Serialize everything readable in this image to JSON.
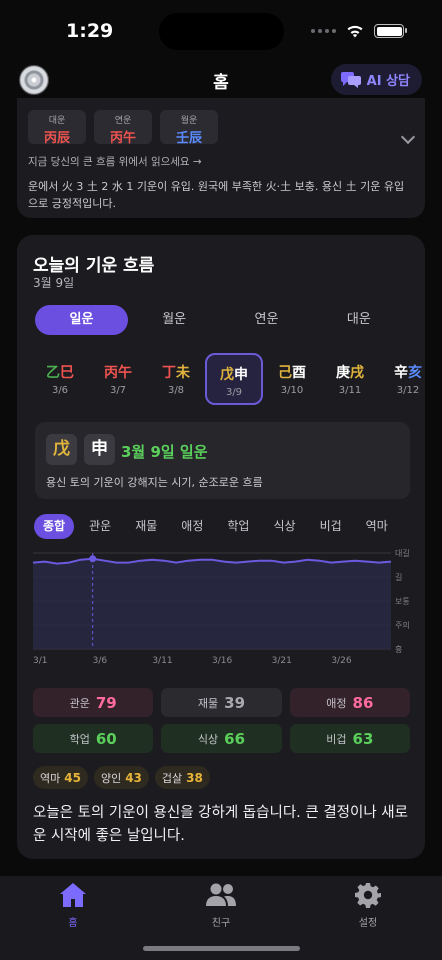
{
  "status": {
    "time": "1:29"
  },
  "nav": {
    "title": "홈",
    "ai_button": "AI 상담"
  },
  "fortune_card": {
    "pills": [
      {
        "label": "대운",
        "value": "丙辰",
        "color": "#ef5350"
      },
      {
        "label": "연운",
        "value": "丙午",
        "color": "#ef5350"
      },
      {
        "label": "월운",
        "value": "壬辰",
        "color": "#5b8cff"
      }
    ],
    "hint": "지금 당신의 큰 흐름 위에서 읽으세요 →",
    "description": "운에서 火 3 土 2 水 1 기운이 유입. 원국에 부족한 火·土 보충. 용신 土 기운 유입으로 긍정적입니다."
  },
  "flow": {
    "title": "오늘의 기운 흐름",
    "date": "3월 9일",
    "segments": [
      "일운",
      "월운",
      "연운",
      "대운"
    ],
    "days": [
      {
        "c1": "乙",
        "c1_color": "#4caf50",
        "c2": "巳",
        "c2_color": "#ef5350",
        "date": "3/6"
      },
      {
        "c1": "丙",
        "c1_color": "#ef5350",
        "c2": "午",
        "c2_color": "#ef5350",
        "date": "3/7"
      },
      {
        "c1": "丁",
        "c1_color": "#ef5350",
        "c2": "未",
        "c2_color": "#e0b43c",
        "date": "3/8"
      },
      {
        "c1": "戊",
        "c1_color": "#e0b43c",
        "c2": "申",
        "c2_color": "#ffffff",
        "date": "3/9"
      },
      {
        "c1": "己",
        "c1_color": "#e0b43c",
        "c2": "酉",
        "c2_color": "#ffffff",
        "date": "3/10"
      },
      {
        "c1": "庚",
        "c1_color": "#ffffff",
        "c2": "戌",
        "c2_color": "#e0b43c",
        "date": "3/11"
      },
      {
        "c1": "辛",
        "c1_color": "#ffffff",
        "c2": "亥",
        "c2_color": "#5b8cff",
        "date": "3/12"
      }
    ],
    "highlight": {
      "char1": "戊",
      "char1_color": "#e0b43c",
      "char2": "申",
      "char2_color": "#ffffff",
      "date_label": "3월 9일 일운",
      "description": "용신 토의 기운이 강해지는 시기, 순조로운 흐름"
    },
    "tabs": [
      "종합",
      "관운",
      "재물",
      "애정",
      "학업",
      "식상",
      "비겁",
      "역마"
    ],
    "scores": [
      {
        "name": "관운",
        "value": "79",
        "tone": "red",
        "color": "#ff6b9d"
      },
      {
        "name": "재물",
        "value": "39",
        "tone": "gray",
        "color": "#a9a9b0"
      },
      {
        "name": "애정",
        "value": "86",
        "tone": "red",
        "color": "#ff6b9d"
      },
      {
        "name": "학업",
        "value": "60",
        "tone": "green",
        "color": "#5bcf5b"
      },
      {
        "name": "식상",
        "value": "66",
        "tone": "green",
        "color": "#5bcf5b"
      },
      {
        "name": "비겁",
        "value": "63",
        "tone": "green",
        "color": "#5bcf5b"
      }
    ],
    "chips": [
      {
        "name": "역마",
        "value": "45"
      },
      {
        "name": "양인",
        "value": "43"
      },
      {
        "name": "겁살",
        "value": "38"
      }
    ],
    "summary": "오늘은 토의 기운이 용신을 강하게 돕습니다. 큰 결정이나 새로운 시작에 좋은 날입니다."
  },
  "chart_data": {
    "type": "area",
    "x_labels": [
      "3/1",
      "3/6",
      "3/11",
      "3/16",
      "3/21",
      "3/26"
    ],
    "y_labels": [
      "대길",
      "길",
      "보통",
      "주의",
      "흉"
    ],
    "marker_x": "3/6",
    "values": [
      0.9,
      0.91,
      0.89,
      0.9,
      0.93,
      0.94,
      0.92,
      0.9,
      0.9,
      0.92,
      0.93,
      0.92,
      0.9,
      0.92,
      0.93,
      0.93,
      0.91,
      0.9,
      0.91,
      0.92,
      0.92,
      0.9,
      0.91,
      0.93,
      0.92,
      0.9,
      0.91,
      0.92,
      0.91,
      0.9,
      0.91
    ]
  },
  "tabbar": {
    "items": [
      {
        "label": "홈",
        "color": "#7c6bff"
      },
      {
        "label": "친구",
        "color": "#a3a3a9"
      },
      {
        "label": "설정",
        "color": "#a3a3a9"
      }
    ]
  }
}
